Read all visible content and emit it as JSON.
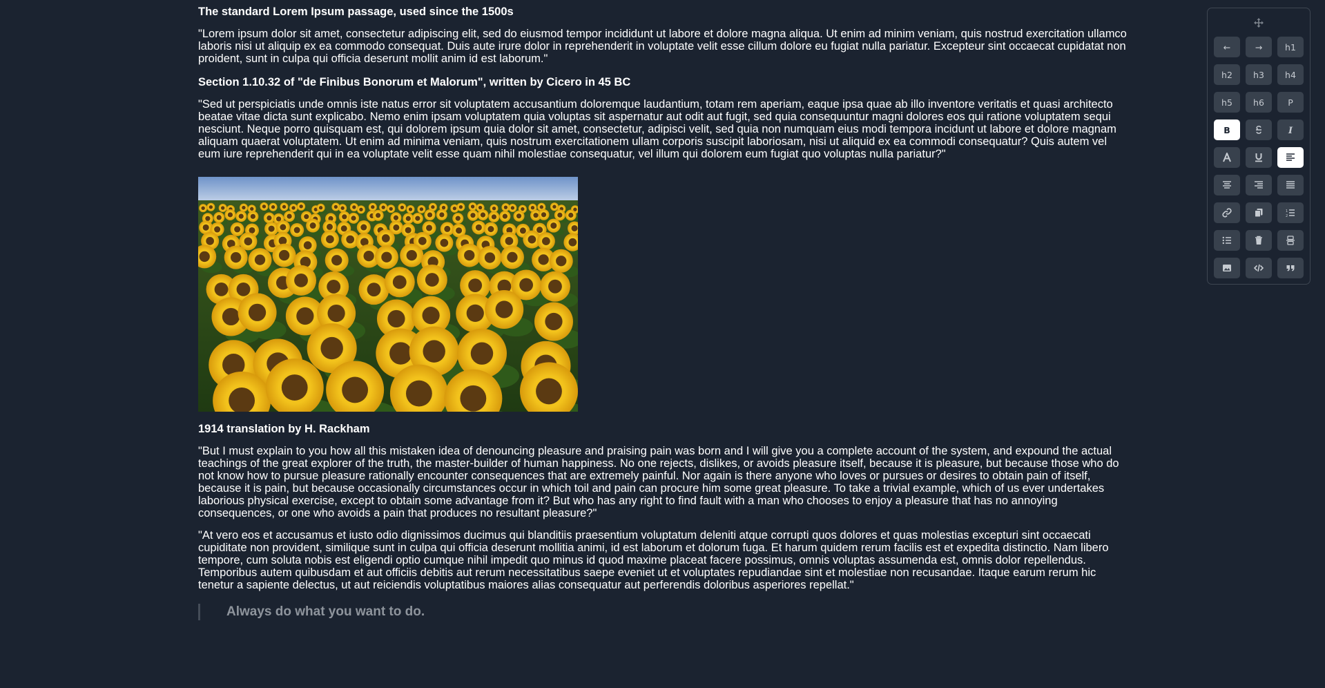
{
  "document": {
    "heading1": "The standard Lorem Ipsum passage, used since the 1500s",
    "para1": "\"Lorem ipsum dolor sit amet, consectetur adipiscing elit, sed do eiusmod tempor incididunt ut labore et dolore magna aliqua. Ut enim ad minim veniam, quis nostrud exercitation ullamco laboris nisi ut aliquip ex ea commodo consequat. Duis aute irure dolor in reprehenderit in voluptate velit esse cillum dolore eu fugiat nulla pariatur. Excepteur sint occaecat cupidatat non proident, sunt in culpa qui officia deserunt mollit anim id est laborum.\"",
    "heading2": "Section 1.10.32 of \"de Finibus Bonorum et Malorum\", written by Cicero in 45 BC",
    "para2": "\"Sed ut perspiciatis unde omnis iste natus error sit voluptatem accusantium doloremque laudantium, totam rem aperiam, eaque ipsa quae ab illo inventore veritatis et quasi architecto beatae vitae dicta sunt explicabo. Nemo enim ipsam voluptatem quia voluptas sit aspernatur aut odit aut fugit, sed quia consequuntur magni dolores eos qui ratione voluptatem sequi nesciunt. Neque porro quisquam est, qui dolorem ipsum quia dolor sit amet, consectetur, adipisci velit, sed quia non numquam eius modi tempora incidunt ut labore et dolore magnam aliquam quaerat voluptatem. Ut enim ad minima veniam, quis nostrum exercitationem ullam corporis suscipit laboriosam, nisi ut aliquid ex ea commodi consequatur? Quis autem vel eum iure reprehenderit qui in ea voluptate velit esse quam nihil molestiae consequatur, vel illum qui dolorem eum fugiat quo voluptas nulla pariatur?\"",
    "heading3": "1914 translation by H. Rackham",
    "para3": "\"But I must explain to you how all this mistaken idea of denouncing pleasure and praising pain was born and I will give you a complete account of the system, and expound the actual teachings of the great explorer of the truth, the master-builder of human happiness. No one rejects, dislikes, or avoids pleasure itself, because it is pleasure, but because those who do not know how to pursue pleasure rationally encounter consequences that are extremely painful. Nor again is there anyone who loves or pursues or desires to obtain pain of itself, because it is pain, but because occasionally circumstances occur in which toil and pain can procure him some great pleasure. To take a trivial example, which of us ever undertakes laborious physical exercise, except to obtain some advantage from it? But who has any right to find fault with a man who chooses to enjoy a pleasure that has no annoying consequences, or one who avoids a pain that produces no resultant pleasure?\"",
    "para4": "\"At vero eos et accusamus et iusto odio dignissimos ducimus qui blanditiis praesentium voluptatum deleniti atque corrupti quos dolores et quas molestias excepturi sint occaecati cupiditate non provident, similique sunt in culpa qui officia deserunt mollitia animi, id est laborum et dolorum fuga. Et harum quidem rerum facilis est et expedita distinctio. Nam libero tempore, cum soluta nobis est eligendi optio cumque nihil impedit quo minus id quod maxime placeat facere possimus, omnis voluptas assumenda est, omnis dolor repellendus. Temporibus autem quibusdam et aut officiis debitis aut rerum necessitatibus saepe eveniet ut et voluptates repudiandae sint et molestiae non recusandae. Itaque earum rerum hic tenetur a sapiente delectus, ut aut reiciendis voluptatibus maiores alias consequatur aut perferendis doloribus asperiores repellat.\"",
    "blockquote": "Always do what you want to do."
  },
  "toolbar": {
    "buttons": [
      {
        "label": "←",
        "icon": "undo-icon",
        "active": false
      },
      {
        "label": "→",
        "icon": "redo-icon",
        "active": false
      },
      {
        "label": "h1",
        "icon": "",
        "active": false
      },
      {
        "label": "h2",
        "icon": "",
        "active": false
      },
      {
        "label": "h3",
        "icon": "",
        "active": false
      },
      {
        "label": "h4",
        "icon": "",
        "active": false
      },
      {
        "label": "h5",
        "icon": "",
        "active": false
      },
      {
        "label": "h6",
        "icon": "",
        "active": false
      },
      {
        "label": "P",
        "icon": "",
        "active": false
      },
      {
        "label": "B",
        "icon": "bold-icon",
        "active": true
      },
      {
        "label": "S",
        "icon": "strikethrough-icon",
        "active": false
      },
      {
        "label": "I",
        "icon": "italic-icon",
        "active": false
      },
      {
        "label": "A",
        "icon": "font-color-icon",
        "active": false
      },
      {
        "label": "U",
        "icon": "underline-icon",
        "active": false
      },
      {
        "label": "",
        "icon": "align-left-icon",
        "active": true
      },
      {
        "label": "",
        "icon": "align-center-icon",
        "active": false
      },
      {
        "label": "",
        "icon": "align-right-icon",
        "active": false
      },
      {
        "label": "",
        "icon": "align-justify-icon",
        "active": false
      },
      {
        "label": "",
        "icon": "link-icon",
        "active": false
      },
      {
        "label": "",
        "icon": "copy-icon",
        "active": false
      },
      {
        "label": "",
        "icon": "ordered-list-icon",
        "active": false
      },
      {
        "label": "",
        "icon": "bullet-list-icon",
        "active": false
      },
      {
        "label": "",
        "icon": "trash-icon",
        "active": false
      },
      {
        "label": "",
        "icon": "page-break-icon",
        "active": false
      },
      {
        "label": "",
        "icon": "image-icon",
        "active": false
      },
      {
        "label": "",
        "icon": "code-icon",
        "active": false
      },
      {
        "label": "",
        "icon": "quote-icon",
        "active": false
      }
    ]
  }
}
